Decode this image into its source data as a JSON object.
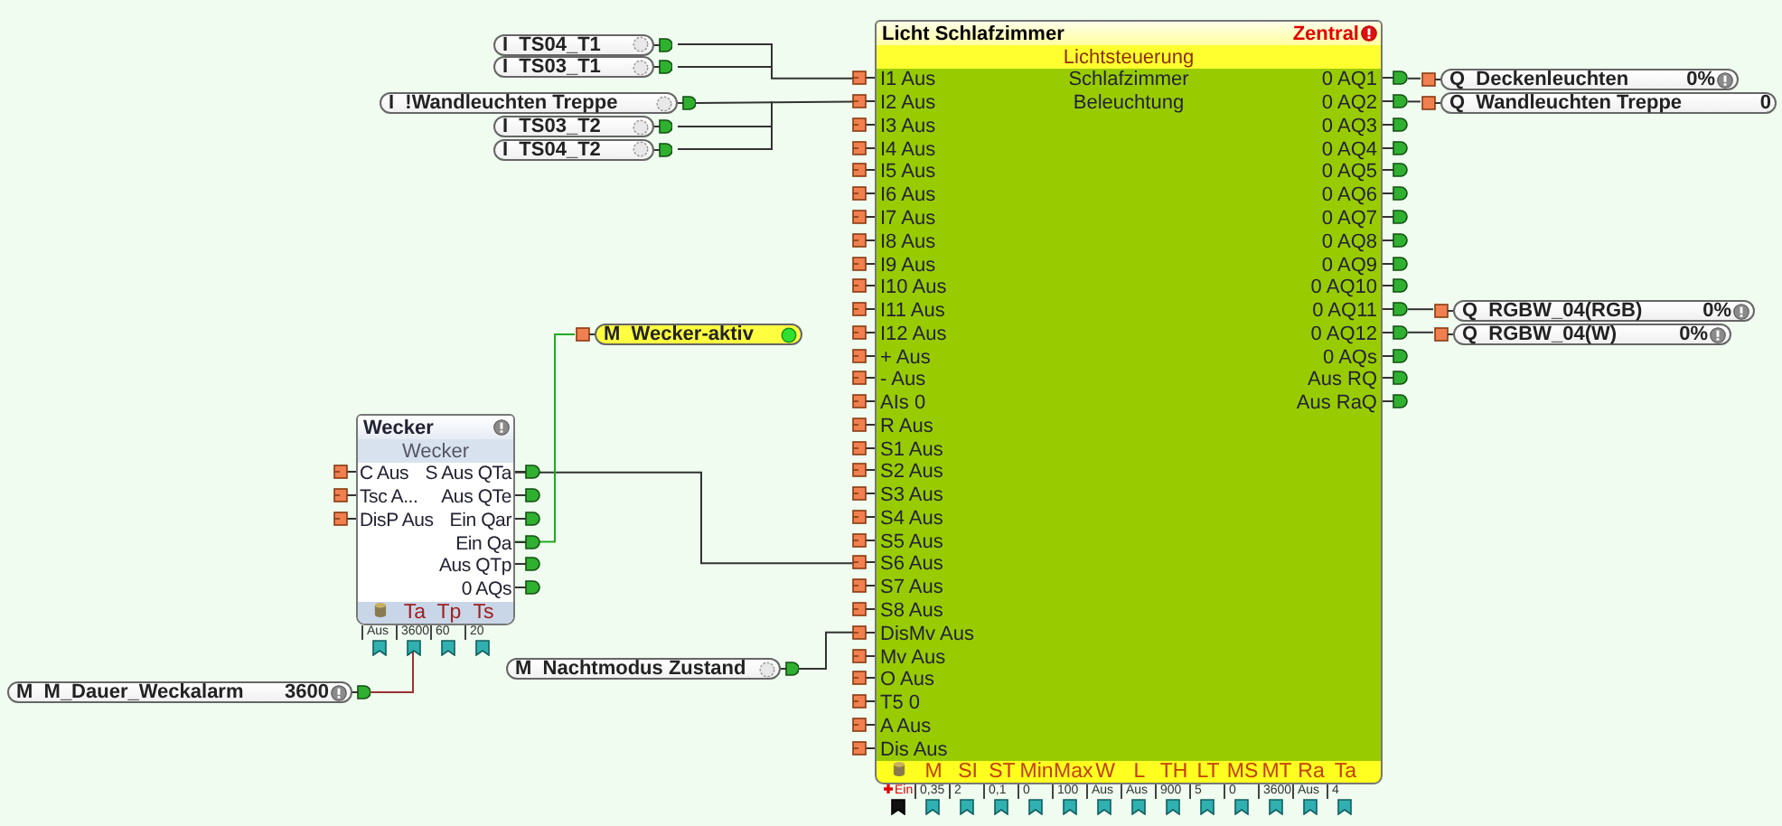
{
  "canvas": {
    "blocks": [
      {
        "kind": "function",
        "title": "Wecker",
        "subtitle": "Wecker",
        "inputs": [
          "C Aus",
          "Tsc A...",
          "DisP Aus"
        ],
        "outputs": [
          "S Aus QTa",
          "Aus QTe",
          "Ein Qar",
          "Ein Qa",
          "Aus QTp",
          "0 AQs"
        ],
        "parameters": [
          {
            "kind": "icon",
            "value": "Aus",
            "highlighted": false
          },
          {
            "kind": "text",
            "label": "Ta",
            "value": "3600",
            "highlighted": false
          },
          {
            "kind": "text",
            "label": "Tp",
            "value": "60",
            "highlighted": false
          },
          {
            "kind": "text",
            "label": "Ts",
            "value": "20",
            "highlighted": false
          }
        ]
      },
      {
        "kind": "program",
        "title": "Licht Schlafzimmer",
        "tag": "Zentral",
        "subtitle": "Lichtsteuerung",
        "description": [
          "Schlafzimmer",
          "Beleuchtung"
        ],
        "inputs": [
          "I1 Aus",
          "I2 Aus",
          "I3 Aus",
          "I4 Aus",
          "I5 Aus",
          "I6 Aus",
          "I7 Aus",
          "I8 Aus",
          "I9 Aus",
          "I10 Aus",
          "I11 Aus",
          "I12 Aus",
          "+ Aus",
          "- Aus",
          "AIs 0",
          "R Aus",
          "S1 Aus",
          "S2 Aus",
          "S3 Aus",
          "S4 Aus",
          "S5 Aus",
          "S6 Aus",
          "S7 Aus",
          "S8 Aus",
          "DisMv Aus",
          "Mv Aus",
          "O Aus",
          "T5 0",
          "A Aus",
          "Dis Aus"
        ],
        "outputs": [
          "0 AQ1",
          "0 AQ2",
          "0 AQ3",
          "0 AQ4",
          "0 AQ5",
          "0 AQ6",
          "0 AQ7",
          "0 AQ8",
          "0 AQ9",
          "0 AQ10",
          "0 AQ11",
          "0 AQ12",
          "0 AQs",
          "Aus RQ",
          "Aus RaQ"
        ],
        "parameters": [
          {
            "kind": "icon",
            "value": "Ein",
            "highlighted": true
          },
          {
            "kind": "text",
            "label": "M",
            "value": "0,35",
            "highlighted": false
          },
          {
            "kind": "text",
            "label": "SI",
            "value": "2",
            "highlighted": false
          },
          {
            "kind": "text",
            "label": "ST",
            "value": "0,1",
            "highlighted": false
          },
          {
            "kind": "text",
            "label": "Min",
            "value": "0",
            "highlighted": false
          },
          {
            "kind": "text",
            "label": "Max",
            "value": "100",
            "highlighted": false
          },
          {
            "kind": "text",
            "label": "W",
            "value": "Aus",
            "highlighted": false
          },
          {
            "kind": "text",
            "label": "L",
            "value": "Aus",
            "highlighted": false
          },
          {
            "kind": "text",
            "label": "TH",
            "value": "900",
            "highlighted": false
          },
          {
            "kind": "text",
            "label": "LT",
            "value": "5",
            "highlighted": false
          },
          {
            "kind": "text",
            "label": "MS",
            "value": "0",
            "highlighted": false
          },
          {
            "kind": "text",
            "label": "MT",
            "value": "3600",
            "highlighted": false
          },
          {
            "kind": "text",
            "label": "Ra",
            "value": "Aus",
            "highlighted": false
          },
          {
            "kind": "text",
            "label": "Ta",
            "value": "4",
            "highlighted": false
          }
        ]
      }
    ],
    "nodes": [
      {
        "kind": "input",
        "label": "I  TS04_T1",
        "active": false
      },
      {
        "kind": "input",
        "label": "I  TS03_T1",
        "active": false
      },
      {
        "kind": "input",
        "label": "I  !Wandleuchten Treppe",
        "active": false
      },
      {
        "kind": "input",
        "label": "I  TS03_T2",
        "active": false
      },
      {
        "kind": "input",
        "label": "I  TS04_T2",
        "active": false
      },
      {
        "kind": "output",
        "label": "M  Wecker-aktiv",
        "active": true
      },
      {
        "kind": "input",
        "label": "M  Nachtmodus Zustand",
        "active": false
      },
      {
        "kind": "input",
        "label": "M  M_Dauer_Weckalarm",
        "value": "3600",
        "info": true
      },
      {
        "kind": "output",
        "label": "Q  Deckenleuchten",
        "value": "0%",
        "info": true
      },
      {
        "kind": "output",
        "label": "Q  Wandleuchten Treppe",
        "value": "0",
        "info": false
      },
      {
        "kind": "output",
        "label": "Q  RGBW_04(RGB)",
        "value": "0%",
        "info": true
      },
      {
        "kind": "output",
        "label": "Q  RGBW_04(W)",
        "value": "0%",
        "info": true
      }
    ]
  }
}
